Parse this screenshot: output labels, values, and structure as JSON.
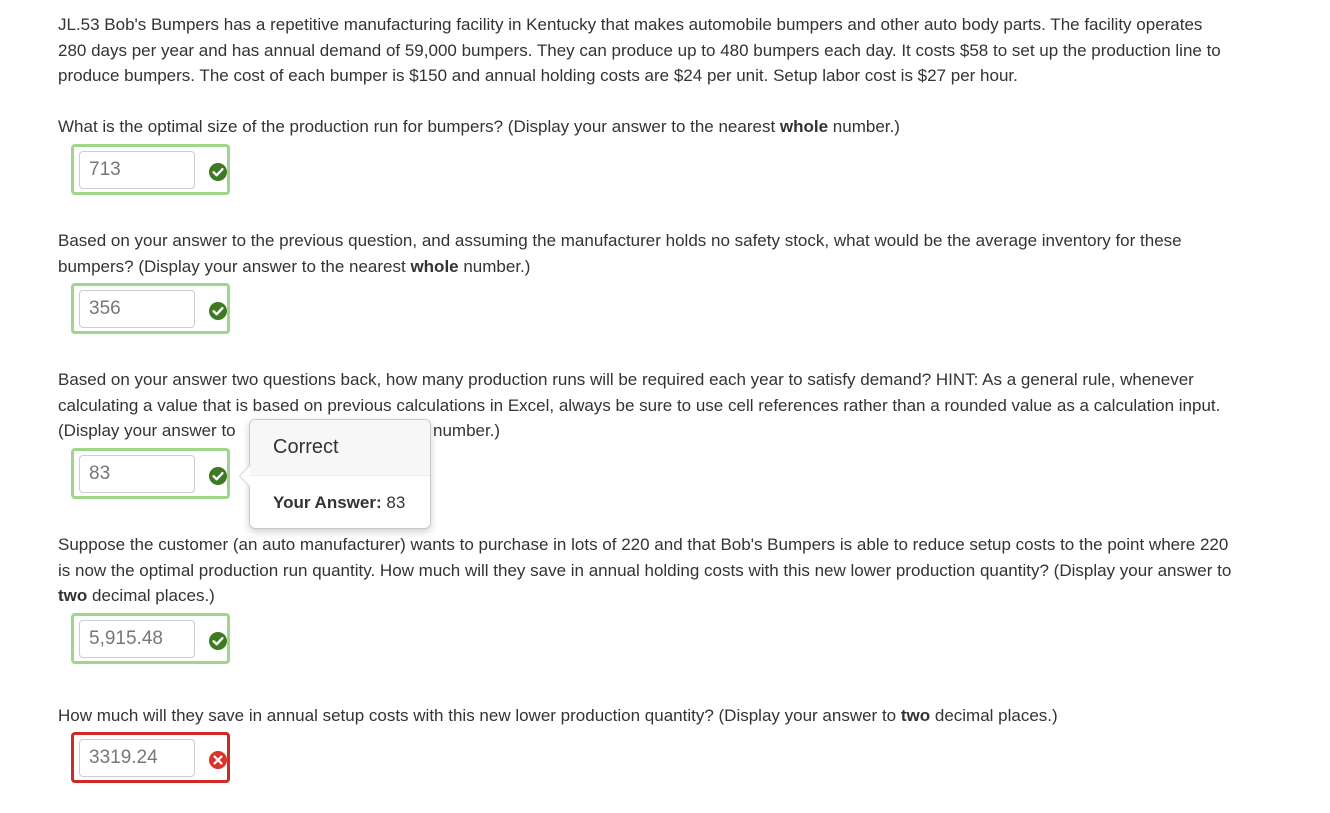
{
  "problem": {
    "line1": "JL.53 Bob's Bumpers has a repetitive manufacturing facility in Kentucky that makes automobile bumpers and other auto body parts. The facility operates",
    "line2": "280 days per year and has annual demand of 59,000 bumpers. They can produce up to 480 bumpers each day. It costs $58 to set up the production line to",
    "line3": "produce bumpers. The cost of each bumper is $150 and annual holding costs are $24 per unit.  Setup labor cost is $27 per hour."
  },
  "questions": [
    {
      "line1_pre": "What is the optimal size of the production run for bumpers? (Display your answer to the nearest ",
      "line1_bold": "whole",
      "line1_post": " number.)",
      "answer": "713",
      "status": "correct"
    },
    {
      "line1": "Based on your answer to the previous question, and assuming the manufacturer holds no safety stock, what would be the average inventory for these",
      "line2_pre": "bumpers? (Display your answer to the nearest ",
      "line2_bold": "whole",
      "line2_post": " number.)",
      "answer": "356",
      "status": "correct"
    },
    {
      "line1": "Based on your answer two questions back, how many production runs will be required each year to satisfy demand? HINT: As a general rule, whenever",
      "line2": "calculating a value that is based on previous calculations in Excel, always be sure to use cell references rather than a rounded value as a calculation input.",
      "line3_pre": "(Display your answer to",
      "line3_post": "number.)",
      "answer": "83",
      "status": "correct"
    },
    {
      "line1": "Suppose the customer (an auto manufacturer) wants to purchase in lots of 220 and that Bob's Bumpers is able to reduce setup costs to the point where 220",
      "line2": "is now the optimal production run quantity. How much will they save in annual holding costs with this new lower production quantity?  (Display your answer to",
      "line3_bold": "two",
      "line3_post": " decimal places.)",
      "answer": "5,915.48",
      "status": "correct"
    },
    {
      "line1_pre": "How much will they save in annual setup costs with this new lower production quantity? (Display your answer to ",
      "line1_bold": "two",
      "line1_post": " decimal places.)",
      "answer": "3319.24",
      "status": "incorrect"
    }
  ],
  "popover": {
    "title": "Correct",
    "answer_label": "Your Answer:",
    "answer_value": "83"
  },
  "colors": {
    "correct_border": "#9fd68c",
    "correct_icon": "#3d7a24",
    "incorrect_border": "#cf2a27",
    "incorrect_icon": "#d9342b"
  },
  "icons": {
    "correct": "check-circle-icon",
    "incorrect": "x-circle-icon"
  }
}
